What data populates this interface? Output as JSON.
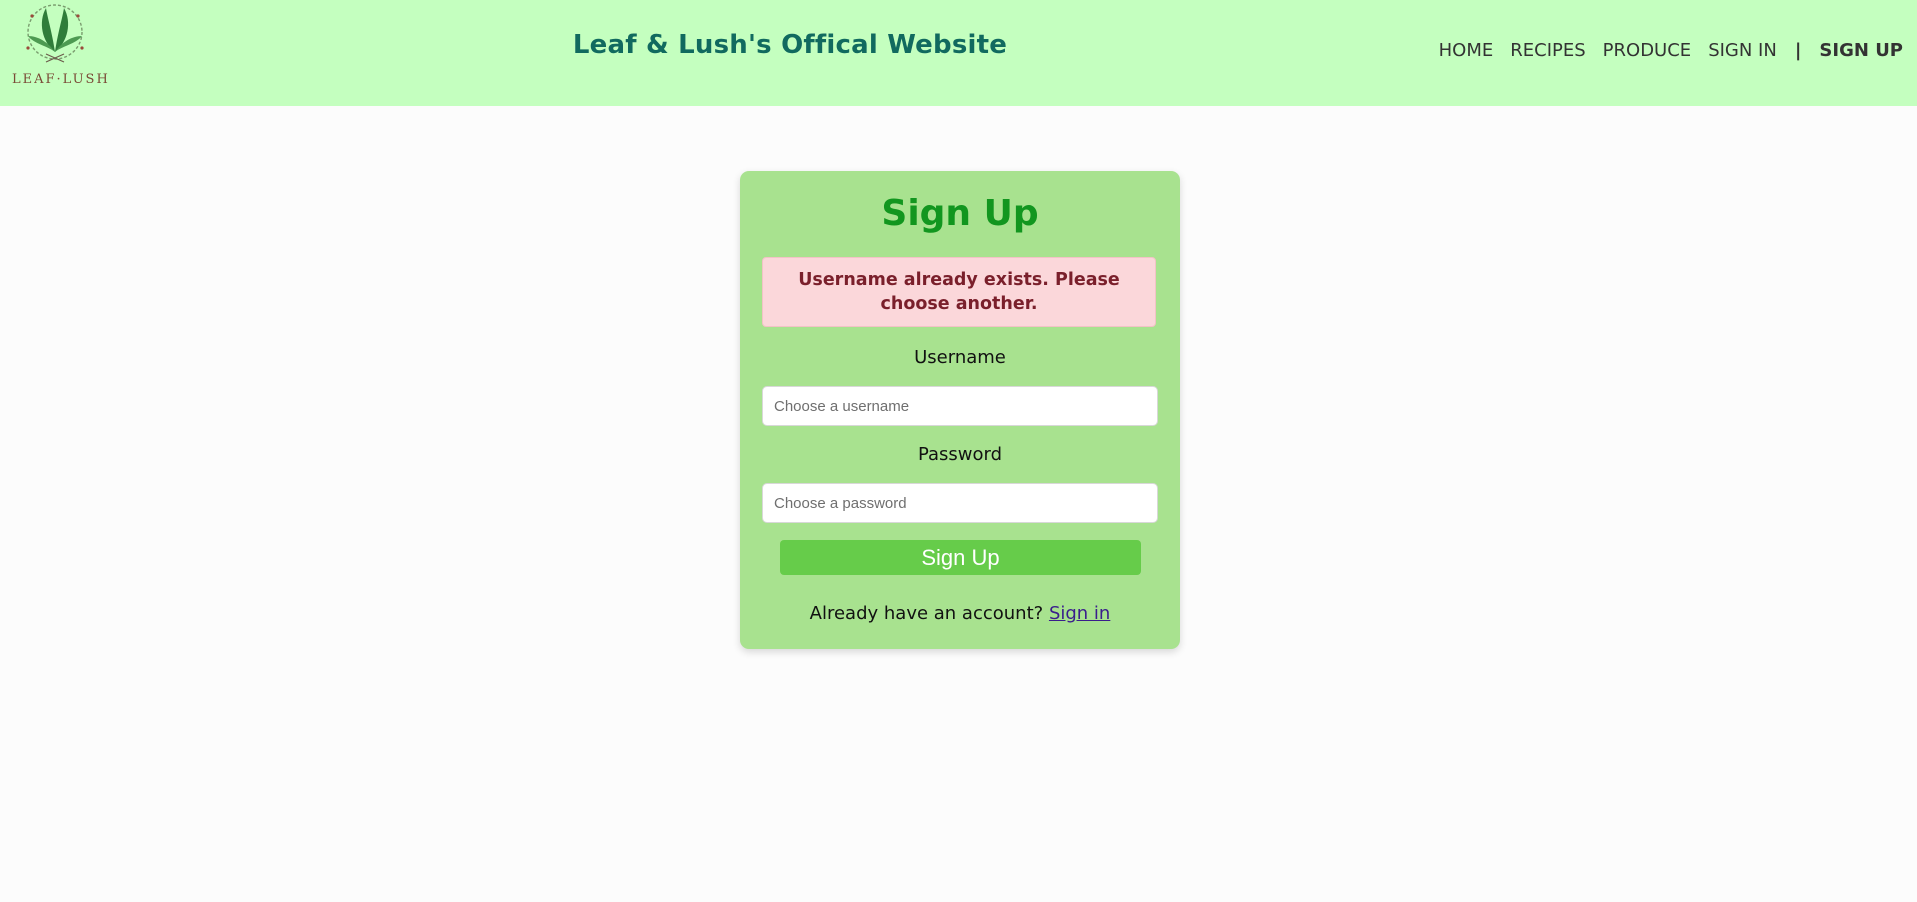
{
  "header": {
    "logo_text": "LEAF·LUSH",
    "title": "Leaf & Lush's Offical Website",
    "nav": {
      "home": "HOME",
      "recipes": "RECIPES",
      "produce": "PRODUCE",
      "sign_in": "SIGN IN",
      "separator": "|",
      "sign_up": "SIGN UP"
    }
  },
  "form": {
    "title": "Sign Up",
    "error_message": "Username already exists. Please choose another.",
    "username_label": "Username",
    "username_placeholder": "Choose a username",
    "username_value": "",
    "password_label": "Password",
    "password_placeholder": "Choose a password",
    "password_value": "",
    "submit_label": "Sign Up",
    "footer_text": "Already have an account?",
    "footer_link": "Sign in"
  },
  "colors": {
    "header_bg": "#c4ffbf",
    "card_bg": "#a8e28f",
    "title_green": "#12961f",
    "site_title": "#116a5f",
    "alert_bg": "#fbd7da",
    "alert_text": "#7a1f2b",
    "button_bg": "#66cc4a"
  },
  "icons": {
    "logo": "leaf-wreath-logo-icon"
  }
}
